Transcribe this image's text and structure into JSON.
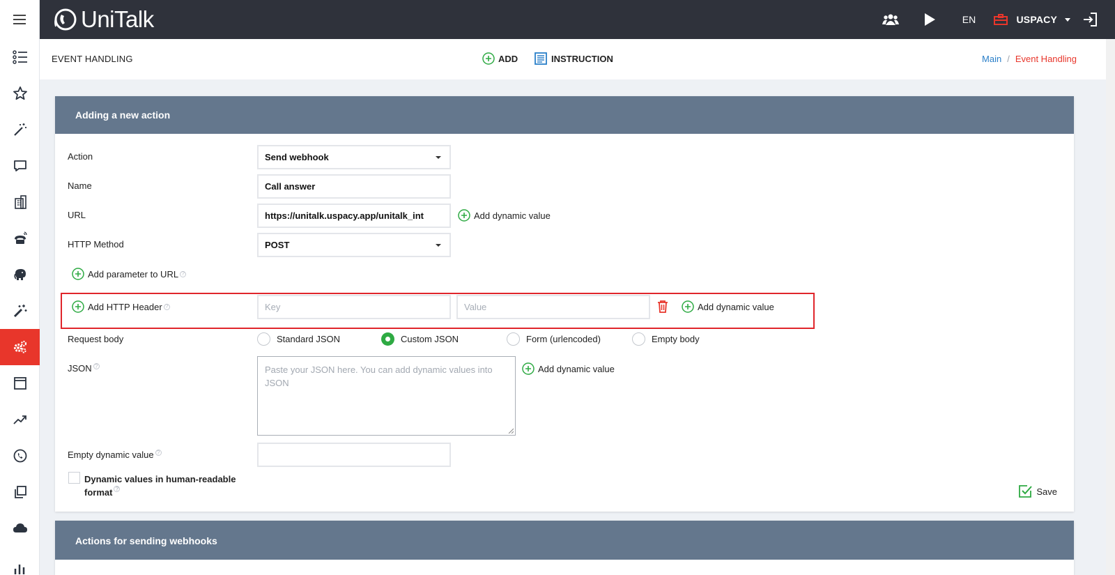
{
  "topbar": {
    "logo_text": "UniTalk",
    "language": "EN",
    "company": "USPACY",
    "icons": [
      "menu-icon",
      "users-icon",
      "play-icon",
      "briefcase-icon",
      "chevron-down-icon",
      "logout-icon"
    ]
  },
  "sidebar": {
    "items": [
      {
        "icon": "list-icon"
      },
      {
        "icon": "star-icon"
      },
      {
        "icon": "magic-wand-icon"
      },
      {
        "icon": "chat-icon"
      },
      {
        "icon": "building-icon"
      },
      {
        "icon": "phone-signal-icon"
      },
      {
        "icon": "elephant-icon"
      },
      {
        "icon": "wand-icon"
      },
      {
        "icon": "gears-icon",
        "active": true
      },
      {
        "icon": "window-icon"
      },
      {
        "icon": "trend-icon"
      },
      {
        "icon": "clock-phone-icon"
      },
      {
        "icon": "copy-icon"
      },
      {
        "icon": "cloud-icon"
      },
      {
        "icon": "bar-chart-icon"
      }
    ]
  },
  "pagehead": {
    "title": "EVENT HANDLING",
    "add_label": "ADD",
    "instruction_label": "INSTRUCTION",
    "breadcrumb": [
      "Main",
      "Event Handling"
    ]
  },
  "form": {
    "panel_title": "Adding a new action",
    "action_label": "Action",
    "action_value": "Send webhook",
    "name_label": "Name",
    "name_value": "Call answer",
    "url_label": "URL",
    "url_value": "https://unitalk.uspacy.app/unitalk_int",
    "http_method_label": "HTTP Method",
    "http_method_value": "POST",
    "add_dynamic_value": "Add dynamic value",
    "add_param_label": "Add parameter to URL",
    "add_header_label": "Add HTTP Header",
    "key_placeholder": "Key",
    "value_placeholder": "Value",
    "request_body_label": "Request body",
    "body_options": [
      "Standard JSON",
      "Custom JSON",
      "Form (urlencoded)",
      "Empty body"
    ],
    "body_selected": "Custom JSON",
    "json_label": "JSON",
    "json_placeholder": "Paste your JSON here. You can add dynamic values into JSON",
    "empty_dynamic_label": "Empty dynamic value",
    "human_readable_label": "Dynamic values in human-readable format",
    "save_label": "Save"
  },
  "panel2": {
    "title": "Actions for sending webhooks"
  },
  "colors": {
    "topbar": "#2f323b",
    "accent_red": "#e8362b",
    "panel_header": "#64778d",
    "green": "#2eaa43",
    "link_blue": "#2a7fc9"
  }
}
